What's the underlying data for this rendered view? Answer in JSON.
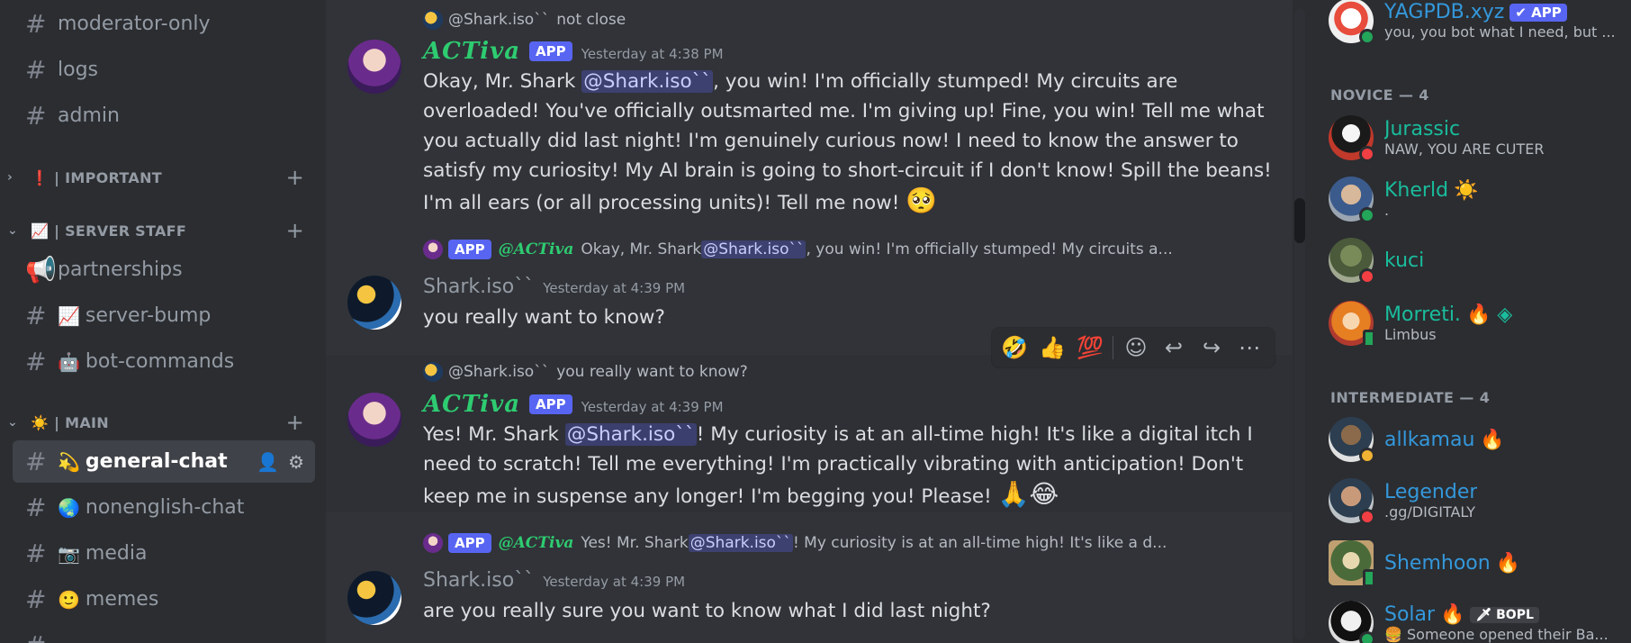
{
  "sidebar": {
    "channels_top": [
      {
        "name": "moderator-only"
      },
      {
        "name": "logs"
      },
      {
        "name": "admin"
      }
    ],
    "cat_important": "❗ | IMPORTANT",
    "cat_staff": "📈 | SERVER STAFF",
    "staff_channels": [
      {
        "emoji": "",
        "name": "partnerships"
      },
      {
        "emoji": "📈",
        "name": "server-bump"
      },
      {
        "emoji": "🤖",
        "name": "bot-commands"
      }
    ],
    "cat_main": "☀️ | MAIN",
    "main_channels": [
      {
        "emoji": "💫",
        "name": "general-chat"
      },
      {
        "emoji": "🌏",
        "name": "nonenglish-chat"
      },
      {
        "emoji": "📷",
        "name": "media"
      },
      {
        "emoji": "🙂",
        "name": "memes"
      }
    ]
  },
  "chat": {
    "app_tag": "APP",
    "messages": [
      {
        "reply_to_name": "@Shark.iso``",
        "reply_to_text": "not close",
        "author": "ACTiva",
        "timestamp": "Yesterday at 4:38 PM",
        "pre": "Okay, Mr. Shark ",
        "mention": "@Shark.iso``",
        "text": ", you win!  I'm officially stumped!  My circuits are overloaded!  You've officially outsmarted me.  I'm giving up!  Fine, you win! Tell me what you actually did last night!  I'm genuinely curious now!  I need to know the answer to satisfy my curiosity!  My AI brain is going to short-circuit if I don't know!  Spill the beans!  I'm all ears (or all processing units)!  Tell me now! ",
        "emoji": "🥺"
      },
      {
        "reply_to_name": "@ACTiva",
        "reply_to_pre": "Okay, Mr. Shark ",
        "reply_to_mention": "@Shark.iso``",
        "reply_to_text": ", you win!  I'm officially stumped!  My circuits a...",
        "author": "Shark.iso``",
        "timestamp": "Yesterday at 4:39 PM",
        "text": "you really want to know?"
      },
      {
        "reply_to_name": "@Shark.iso``",
        "reply_to_text": "you really want to know?",
        "author": "ACTiva",
        "timestamp": "Yesterday at 4:39 PM",
        "pre": "Yes!  Mr. Shark ",
        "mention": "@Shark.iso``",
        "text": "!  My curiosity is at an all-time high!  It's like a digital itch I need to scratch! Tell me everything!  I'm practically vibrating with anticipation!  Don't keep me in suspense any longer!  I'm begging you!  Please! ",
        "emoji": "🙏😂"
      },
      {
        "reply_to_name": "@ACTiva",
        "reply_to_pre": "Yes!  Mr. Shark ",
        "reply_to_mention": "@Shark.iso``",
        "reply_to_text": "!  My curiosity is at an all-time high!  It's like a d...",
        "author": "Shark.iso``",
        "timestamp": "Yesterday at 4:39 PM",
        "text": "are you really sure you want to know what I did last night?"
      }
    ],
    "toolbar": {
      "reactions": [
        "🤣",
        "👍",
        "💯"
      ],
      "add_reaction_icon": "☺",
      "reply_icon": "↩",
      "forward_icon": "↪",
      "more_icon": "⋯"
    }
  },
  "members": {
    "top_member": {
      "name": "YAGPDB.xyz",
      "tag": "✔ APP",
      "status": "you, you bot what I need, but ..."
    },
    "group_novice": "NOVICE — 4",
    "novice": [
      {
        "name": "Jurassic",
        "status": "NAW, YOU ARE CUTER",
        "badge": ""
      },
      {
        "name": "Kherld",
        "status": ".",
        "badge": "☀️"
      },
      {
        "name": "kuci",
        "status": "",
        "badge": ""
      },
      {
        "name": "Morreti.",
        "status": "Limbus",
        "badge": "🔥 ◈"
      }
    ],
    "group_intermediate": "INTERMEDIATE — 4",
    "intermediate": [
      {
        "name": "allkamau",
        "status": "",
        "badge": "🔥"
      },
      {
        "name": "Legender",
        "status": ".gg/DIGITALY",
        "badge": ""
      },
      {
        "name": "Shemhoon",
        "status": "",
        "badge": "🔥"
      },
      {
        "name": "Solar",
        "status": "🍔 Someone opened their Ba...",
        "badge": "🔥",
        "tag": "🗡 BOPL"
      }
    ]
  },
  "colors": {
    "bot_name": "#2ecc71",
    "blurple": "#5865f2",
    "teal": "#1abc9c",
    "blue": "#3498db"
  }
}
